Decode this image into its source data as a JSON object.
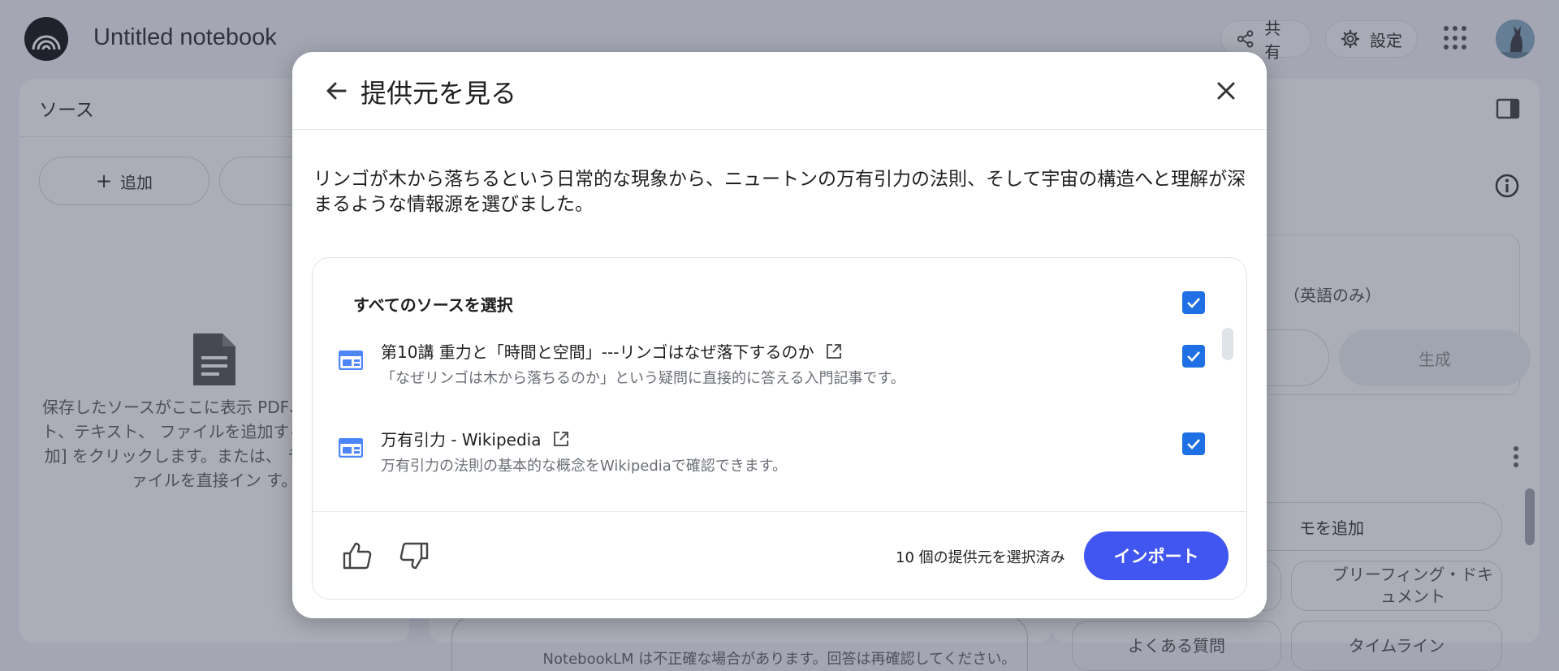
{
  "app": {
    "notebook_title": "Untitled notebook",
    "share_label": "共有",
    "settings_label": "設定"
  },
  "sources_panel": {
    "title": "ソース",
    "add_label": "追加",
    "empty_text": "保存したソースがここに表示 PDF、ウェブサイト、テキスト、 ファイルを追加するには、上の 加] をクリックします。または、 ライブからファイルを直接イン す。"
  },
  "studio_panel": {
    "audio_lang_note": "（英語のみ）",
    "generate_label": "生成",
    "add_note_label": "モを追加",
    "chip_brief": "ブリーフィング・ドキュメント",
    "chip_faq": "よくある質問",
    "chip_timeline": "タイムライン"
  },
  "footer_note": "NotebookLM は不正確な場合があります。回答は再確認してください。",
  "dialog": {
    "title": "提供元を見る",
    "description": "リンゴが木から落ちるという日常的な現象から、ニュートンの万有引力の法則、そして宇宙の構造へと理解が深まるような情報源を選びました。",
    "select_all_label": "すべてのソースを選択",
    "sources": [
      {
        "title": "第10講 重力と「時間と空間」---リンゴはなぜ落下するのか",
        "description": "「なぜリンゴは木から落ちるのか」という疑問に直接的に答える入門記事です。"
      },
      {
        "title": "万有引力 - Wikipedia",
        "description": "万有引力の法則の基本的な概念をWikipediaで確認できます。"
      }
    ],
    "selected_count_text": "10 個の提供元を選択済み",
    "import_label": "インポート"
  },
  "colors": {
    "accent": "#4155f0",
    "checkbox": "#1f6fe5",
    "source_icon": "#4f86f7"
  }
}
